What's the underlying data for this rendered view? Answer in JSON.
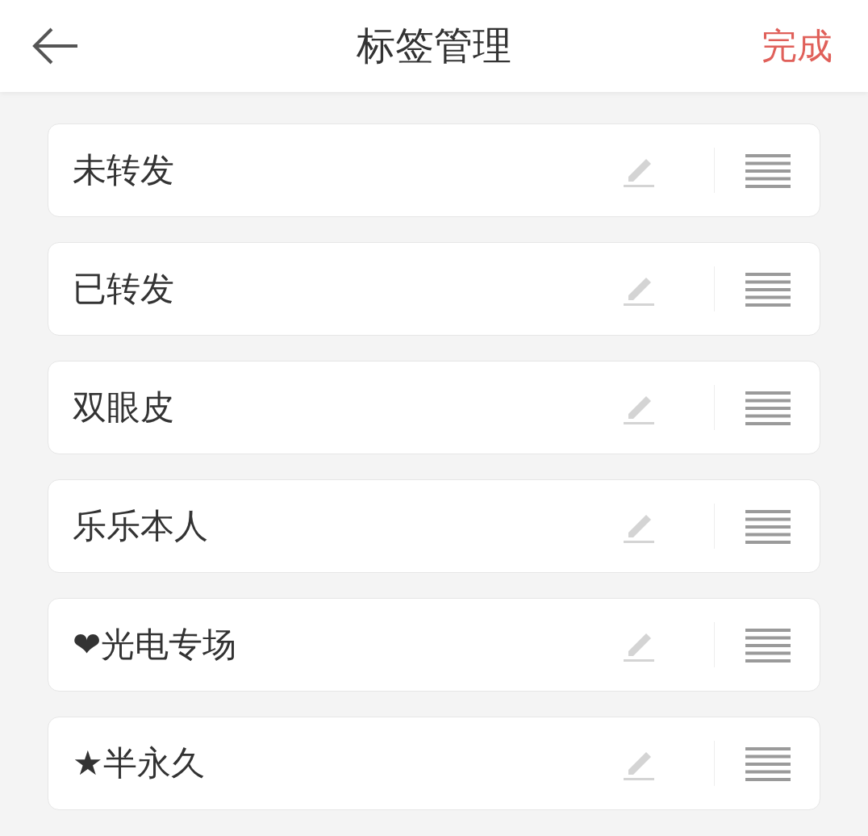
{
  "header": {
    "title": "标签管理",
    "action": "完成"
  },
  "tags": [
    {
      "label": "未转发"
    },
    {
      "label": "已转发"
    },
    {
      "label": "双眼皮"
    },
    {
      "label": "乐乐本人"
    },
    {
      "label": "❤光电专场"
    },
    {
      "label": "★半永久"
    }
  ]
}
